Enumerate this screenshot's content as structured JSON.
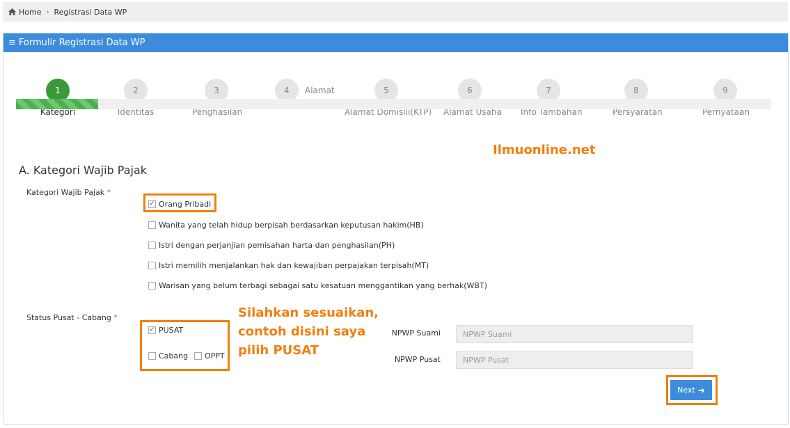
{
  "breadcrumb": {
    "home": "Home",
    "current": "Registrasi Data WP"
  },
  "panel": {
    "title": "Formulir Registrasi Data WP"
  },
  "steps": [
    {
      "num": "1",
      "label": "Kategori"
    },
    {
      "num": "2",
      "label": "Identitas"
    },
    {
      "num": "3",
      "label": "Penghasilan"
    },
    {
      "num": "4",
      "label": "Alamat"
    },
    {
      "num": "5",
      "label": "Alamat Domisili(KTP)"
    },
    {
      "num": "6",
      "label": "Alamat Usaha"
    },
    {
      "num": "7",
      "label": "Info Tambahan"
    },
    {
      "num": "8",
      "label": "Persyaratan"
    },
    {
      "num": "9",
      "label": "Pernyataan"
    }
  ],
  "progress": {
    "current_step": 1,
    "total_steps": 9
  },
  "watermark": "Ilmuonline.net",
  "section": {
    "title": "A. Kategori Wajib Pajak"
  },
  "kategori": {
    "label": "Kategori Wajib Pajak",
    "required": "*",
    "options": [
      {
        "label": "Orang Pribadi",
        "checked": true
      },
      {
        "label": "Wanita yang telah hidup berpisah berdasarkan keputusan hakim(HB)",
        "checked": false
      },
      {
        "label": "Istri dengan perjanjian pemisahan harta dan penghasilan(PH)",
        "checked": false
      },
      {
        "label": "Istri memilih menjalankan hak dan kewajiban perpajakan terpisah(MT)",
        "checked": false
      },
      {
        "label": "Warisan yang belum terbagi sebagai satu kesatuan menggantikan yang berhak(WBT)",
        "checked": false
      }
    ]
  },
  "status": {
    "label": "Status Pusat - Cabang",
    "required": "*",
    "options": [
      {
        "label": "PUSAT",
        "checked": true
      },
      {
        "label": "Cabang",
        "checked": false
      },
      {
        "label": "OPPT",
        "checked": false
      }
    ]
  },
  "annotation": {
    "line1": "Silahkan sesuaikan,",
    "line2": "contoh disini saya",
    "line3": "pilih PUSAT"
  },
  "npwp_suami": {
    "label": "NPWP Suami",
    "placeholder": "NPWP Suami"
  },
  "npwp_pusat": {
    "label": "NPWP Pusat",
    "placeholder": "NPWP Pusat"
  },
  "next_button": {
    "label": "Next"
  },
  "colors": {
    "header": "#3c8cdb",
    "active_step": "#3a9a3a",
    "highlight": "#f07f0e",
    "required": "#d9534f"
  }
}
